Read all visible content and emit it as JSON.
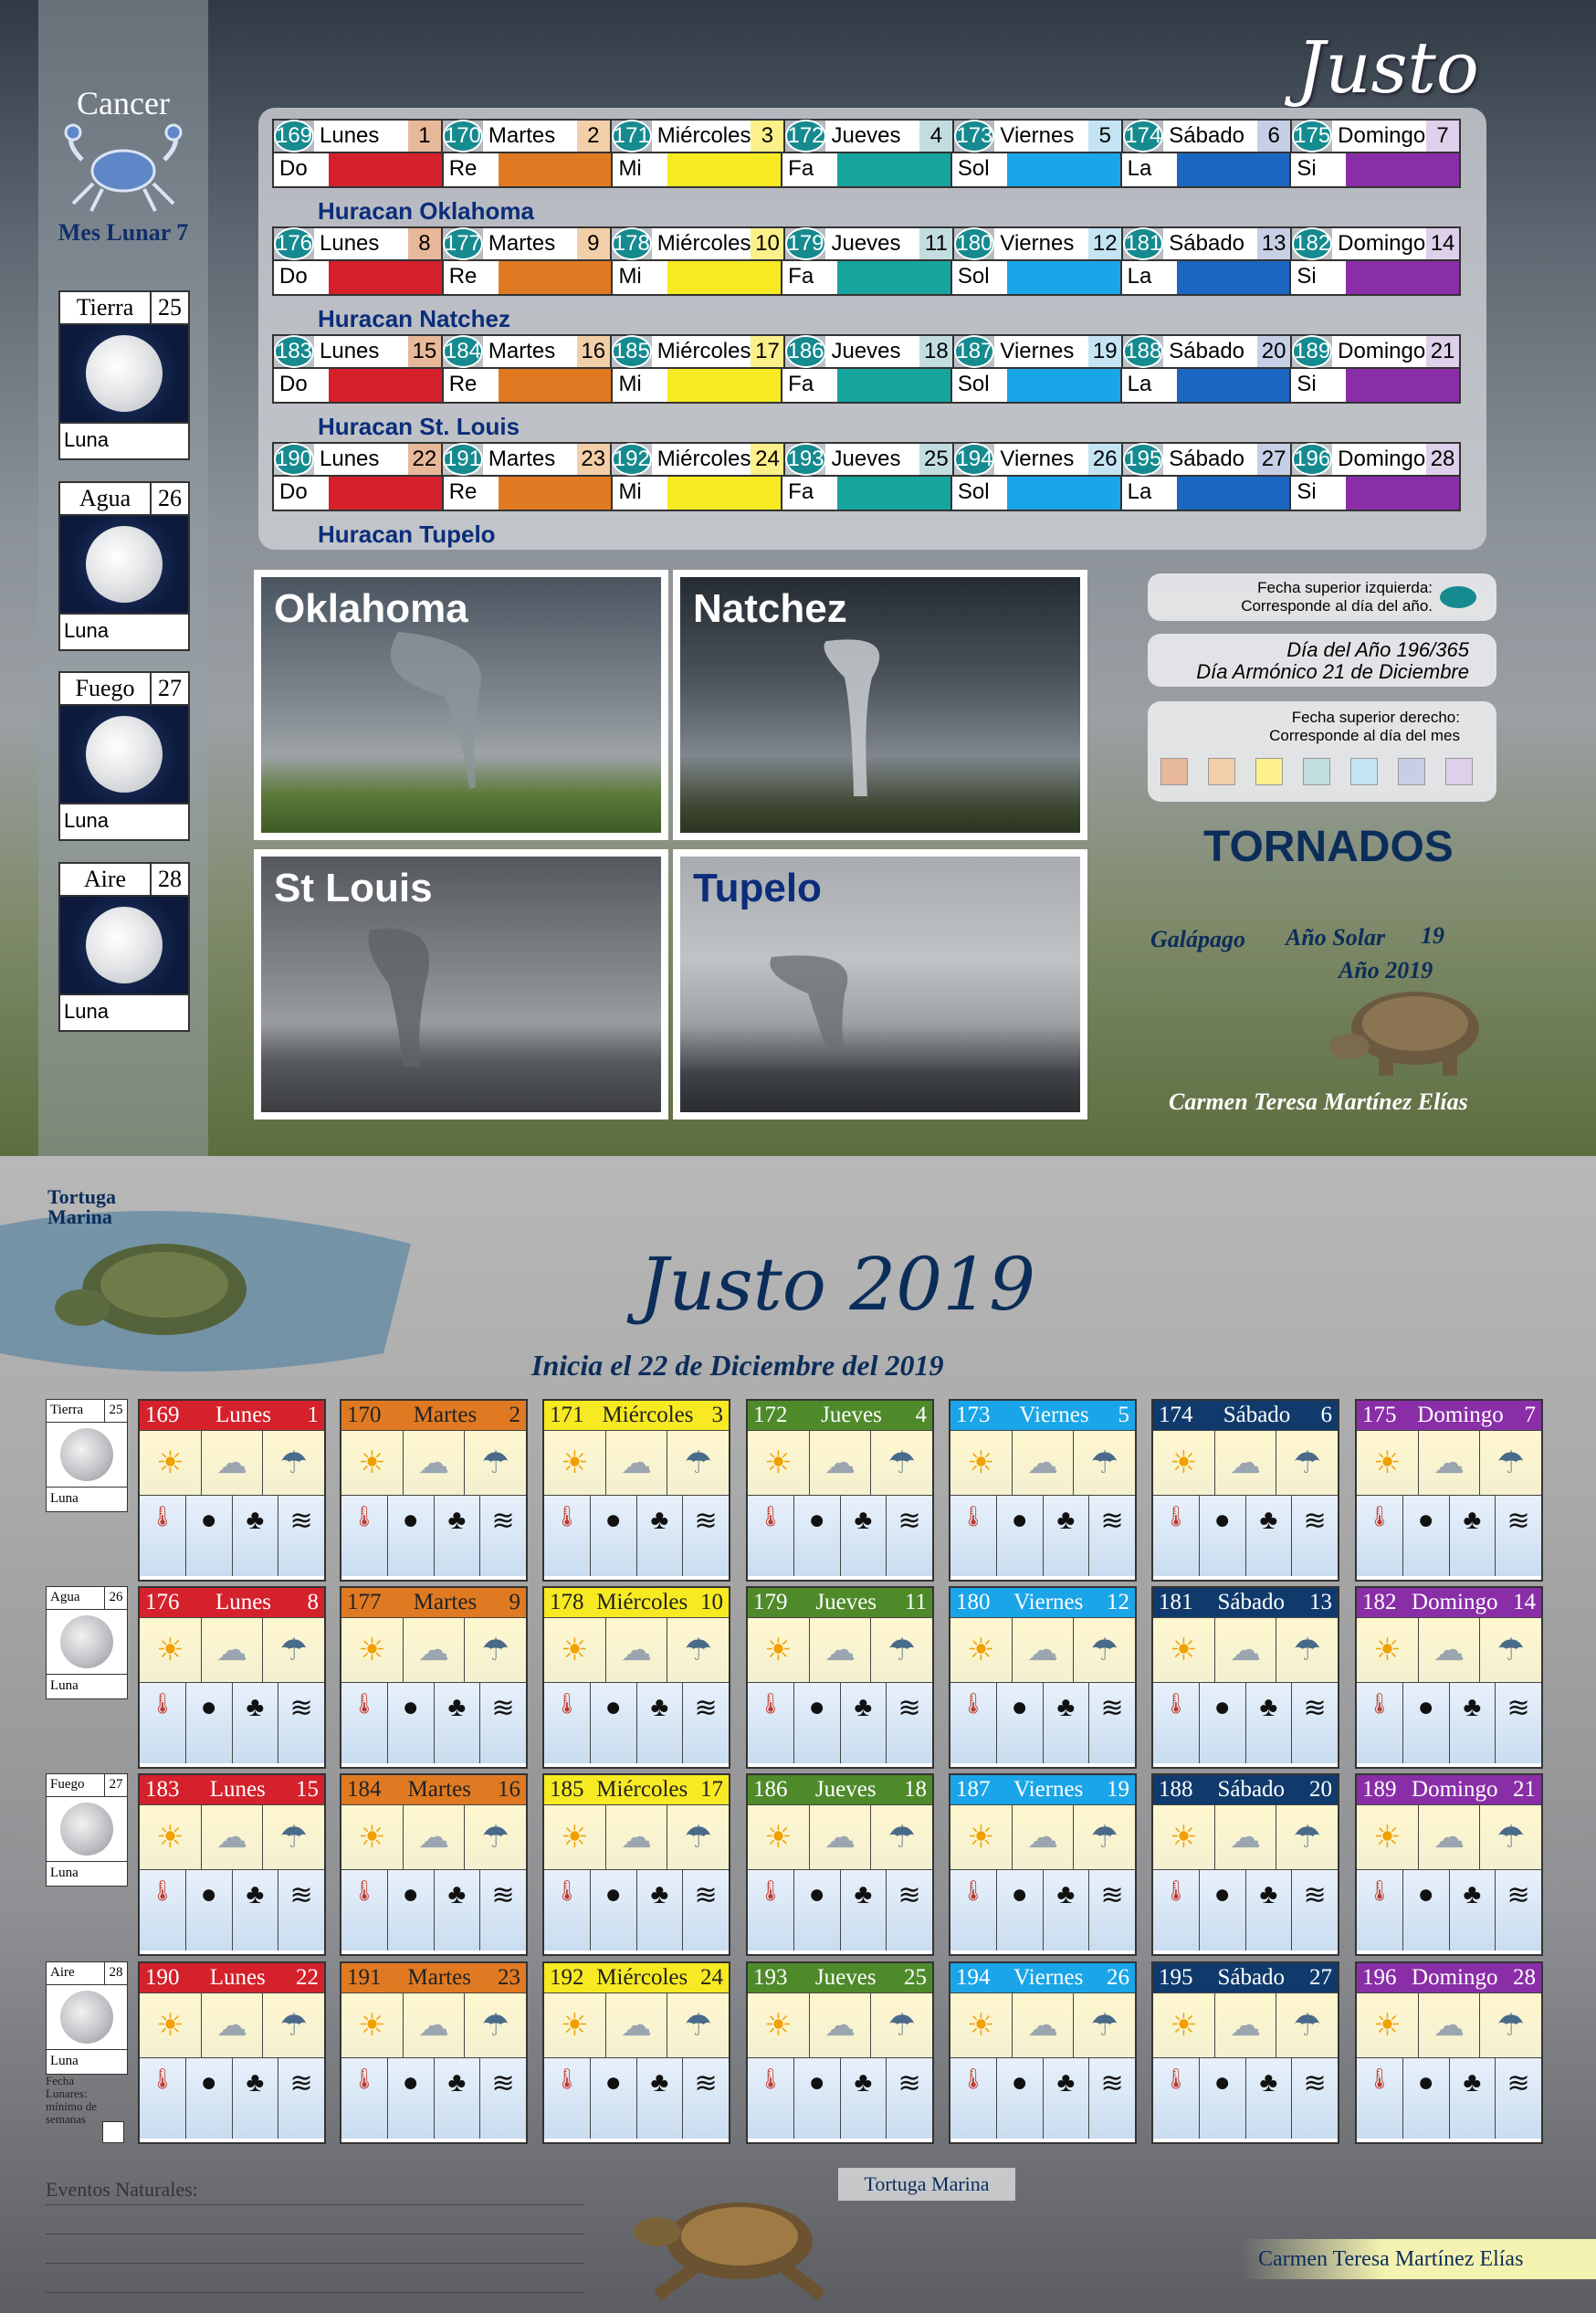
{
  "brand_top": "Justo",
  "sign": "Cancer",
  "mes_lunar": "Mes Lunar 7",
  "moon_cards": [
    {
      "element": "Tierra",
      "num": "25",
      "label": "Luna"
    },
    {
      "element": "Agua",
      "num": "26",
      "label": "Luna"
    },
    {
      "element": "Fuego",
      "num": "27",
      "label": "Luna"
    },
    {
      "element": "Aire",
      "num": "28",
      "label": "Luna"
    }
  ],
  "day_colors": [
    "#e8b89a",
    "#f2cfa8",
    "#fbf08a",
    "#c2dde0",
    "#c4e4f3",
    "#c7cfe6",
    "#ded0ea"
  ],
  "planet_colors": [
    "#d4212c",
    "#e07a22",
    "#f7ea22",
    "#16a59e",
    "#1aa5e8",
    "#1a66c0",
    "#8a2ea8"
  ],
  "planets": [
    "Do",
    "Re",
    "Mi",
    "Fa",
    "Sol",
    "La",
    "Si"
  ],
  "weeks": [
    {
      "days": [
        {
          "n": "169",
          "name": "Lunes",
          "dom": "1"
        },
        {
          "n": "170",
          "name": "Martes",
          "dom": "2"
        },
        {
          "n": "171",
          "name": "Miércoles",
          "dom": "3"
        },
        {
          "n": "172",
          "name": "Jueves",
          "dom": "4"
        },
        {
          "n": "173",
          "name": "Viernes",
          "dom": "5"
        },
        {
          "n": "174",
          "name": "Sábado",
          "dom": "6"
        },
        {
          "n": "175",
          "name": "Domingo",
          "dom": "7"
        }
      ],
      "hurricane": "Huracan Oklahoma"
    },
    {
      "days": [
        {
          "n": "176",
          "name": "Lunes",
          "dom": "8"
        },
        {
          "n": "177",
          "name": "Martes",
          "dom": "9"
        },
        {
          "n": "178",
          "name": "Miércoles",
          "dom": "10"
        },
        {
          "n": "179",
          "name": "Jueves",
          "dom": "11"
        },
        {
          "n": "180",
          "name": "Viernes",
          "dom": "12"
        },
        {
          "n": "181",
          "name": "Sábado",
          "dom": "13"
        },
        {
          "n": "182",
          "name": "Domingo",
          "dom": "14"
        }
      ],
      "hurricane": "Huracan Natchez"
    },
    {
      "days": [
        {
          "n": "183",
          "name": "Lunes",
          "dom": "15"
        },
        {
          "n": "184",
          "name": "Martes",
          "dom": "16"
        },
        {
          "n": "185",
          "name": "Miércoles",
          "dom": "17"
        },
        {
          "n": "186",
          "name": "Jueves",
          "dom": "18"
        },
        {
          "n": "187",
          "name": "Viernes",
          "dom": "19"
        },
        {
          "n": "188",
          "name": "Sábado",
          "dom": "20"
        },
        {
          "n": "189",
          "name": "Domingo",
          "dom": "21"
        }
      ],
      "hurricane": "Huracan St. Louis"
    },
    {
      "days": [
        {
          "n": "190",
          "name": "Lunes",
          "dom": "22"
        },
        {
          "n": "191",
          "name": "Martes",
          "dom": "23"
        },
        {
          "n": "192",
          "name": "Miércoles",
          "dom": "24"
        },
        {
          "n": "193",
          "name": "Jueves",
          "dom": "25"
        },
        {
          "n": "194",
          "name": "Viernes",
          "dom": "26"
        },
        {
          "n": "195",
          "name": "Sábado",
          "dom": "27"
        },
        {
          "n": "196",
          "name": "Domingo",
          "dom": "28"
        }
      ],
      "hurricane": "Huracan Tupelo"
    }
  ],
  "photos": [
    {
      "caption": "Oklahoma",
      "color": "#ffffff"
    },
    {
      "caption": "Natchez",
      "color": "#ffffff"
    },
    {
      "caption": "St Louis",
      "color": "#ffffff"
    },
    {
      "caption": "Tupelo",
      "color": "#0b2d7a"
    }
  ],
  "info": {
    "left_date_title": "Fecha superior izquierda:",
    "left_date_desc": "Corresponde al día del año.",
    "dia_del_ano": "Día del Año 196/365",
    "dia_armonico": "Día Armónico 21 de Diciembre",
    "right_date_title": "Fecha superior derecho:",
    "right_date_desc": "Corresponde al día del mes"
  },
  "tornados": "TORNADOS",
  "galapago": "Galápago",
  "ano_solar_label": "Año Solar",
  "ano_solar": "19",
  "ano": "Año 2019",
  "author": "Carmen Teresa Martínez Elías",
  "tortuga_marina": "Tortuga Marina",
  "bottom_title": "Justo 2019",
  "bottom_sub": "Inicia el 22 de Diciembre del 2019",
  "fecha_note": "Fecha Lunares: mínimo de semanas",
  "eventos": "Eventos Naturales:",
  "weather_icons": [
    "sun-icon",
    "cloud-icon",
    "rain-icon",
    "thermometer-icon",
    "moon-icon",
    "palm-icon",
    "wind-icon"
  ]
}
